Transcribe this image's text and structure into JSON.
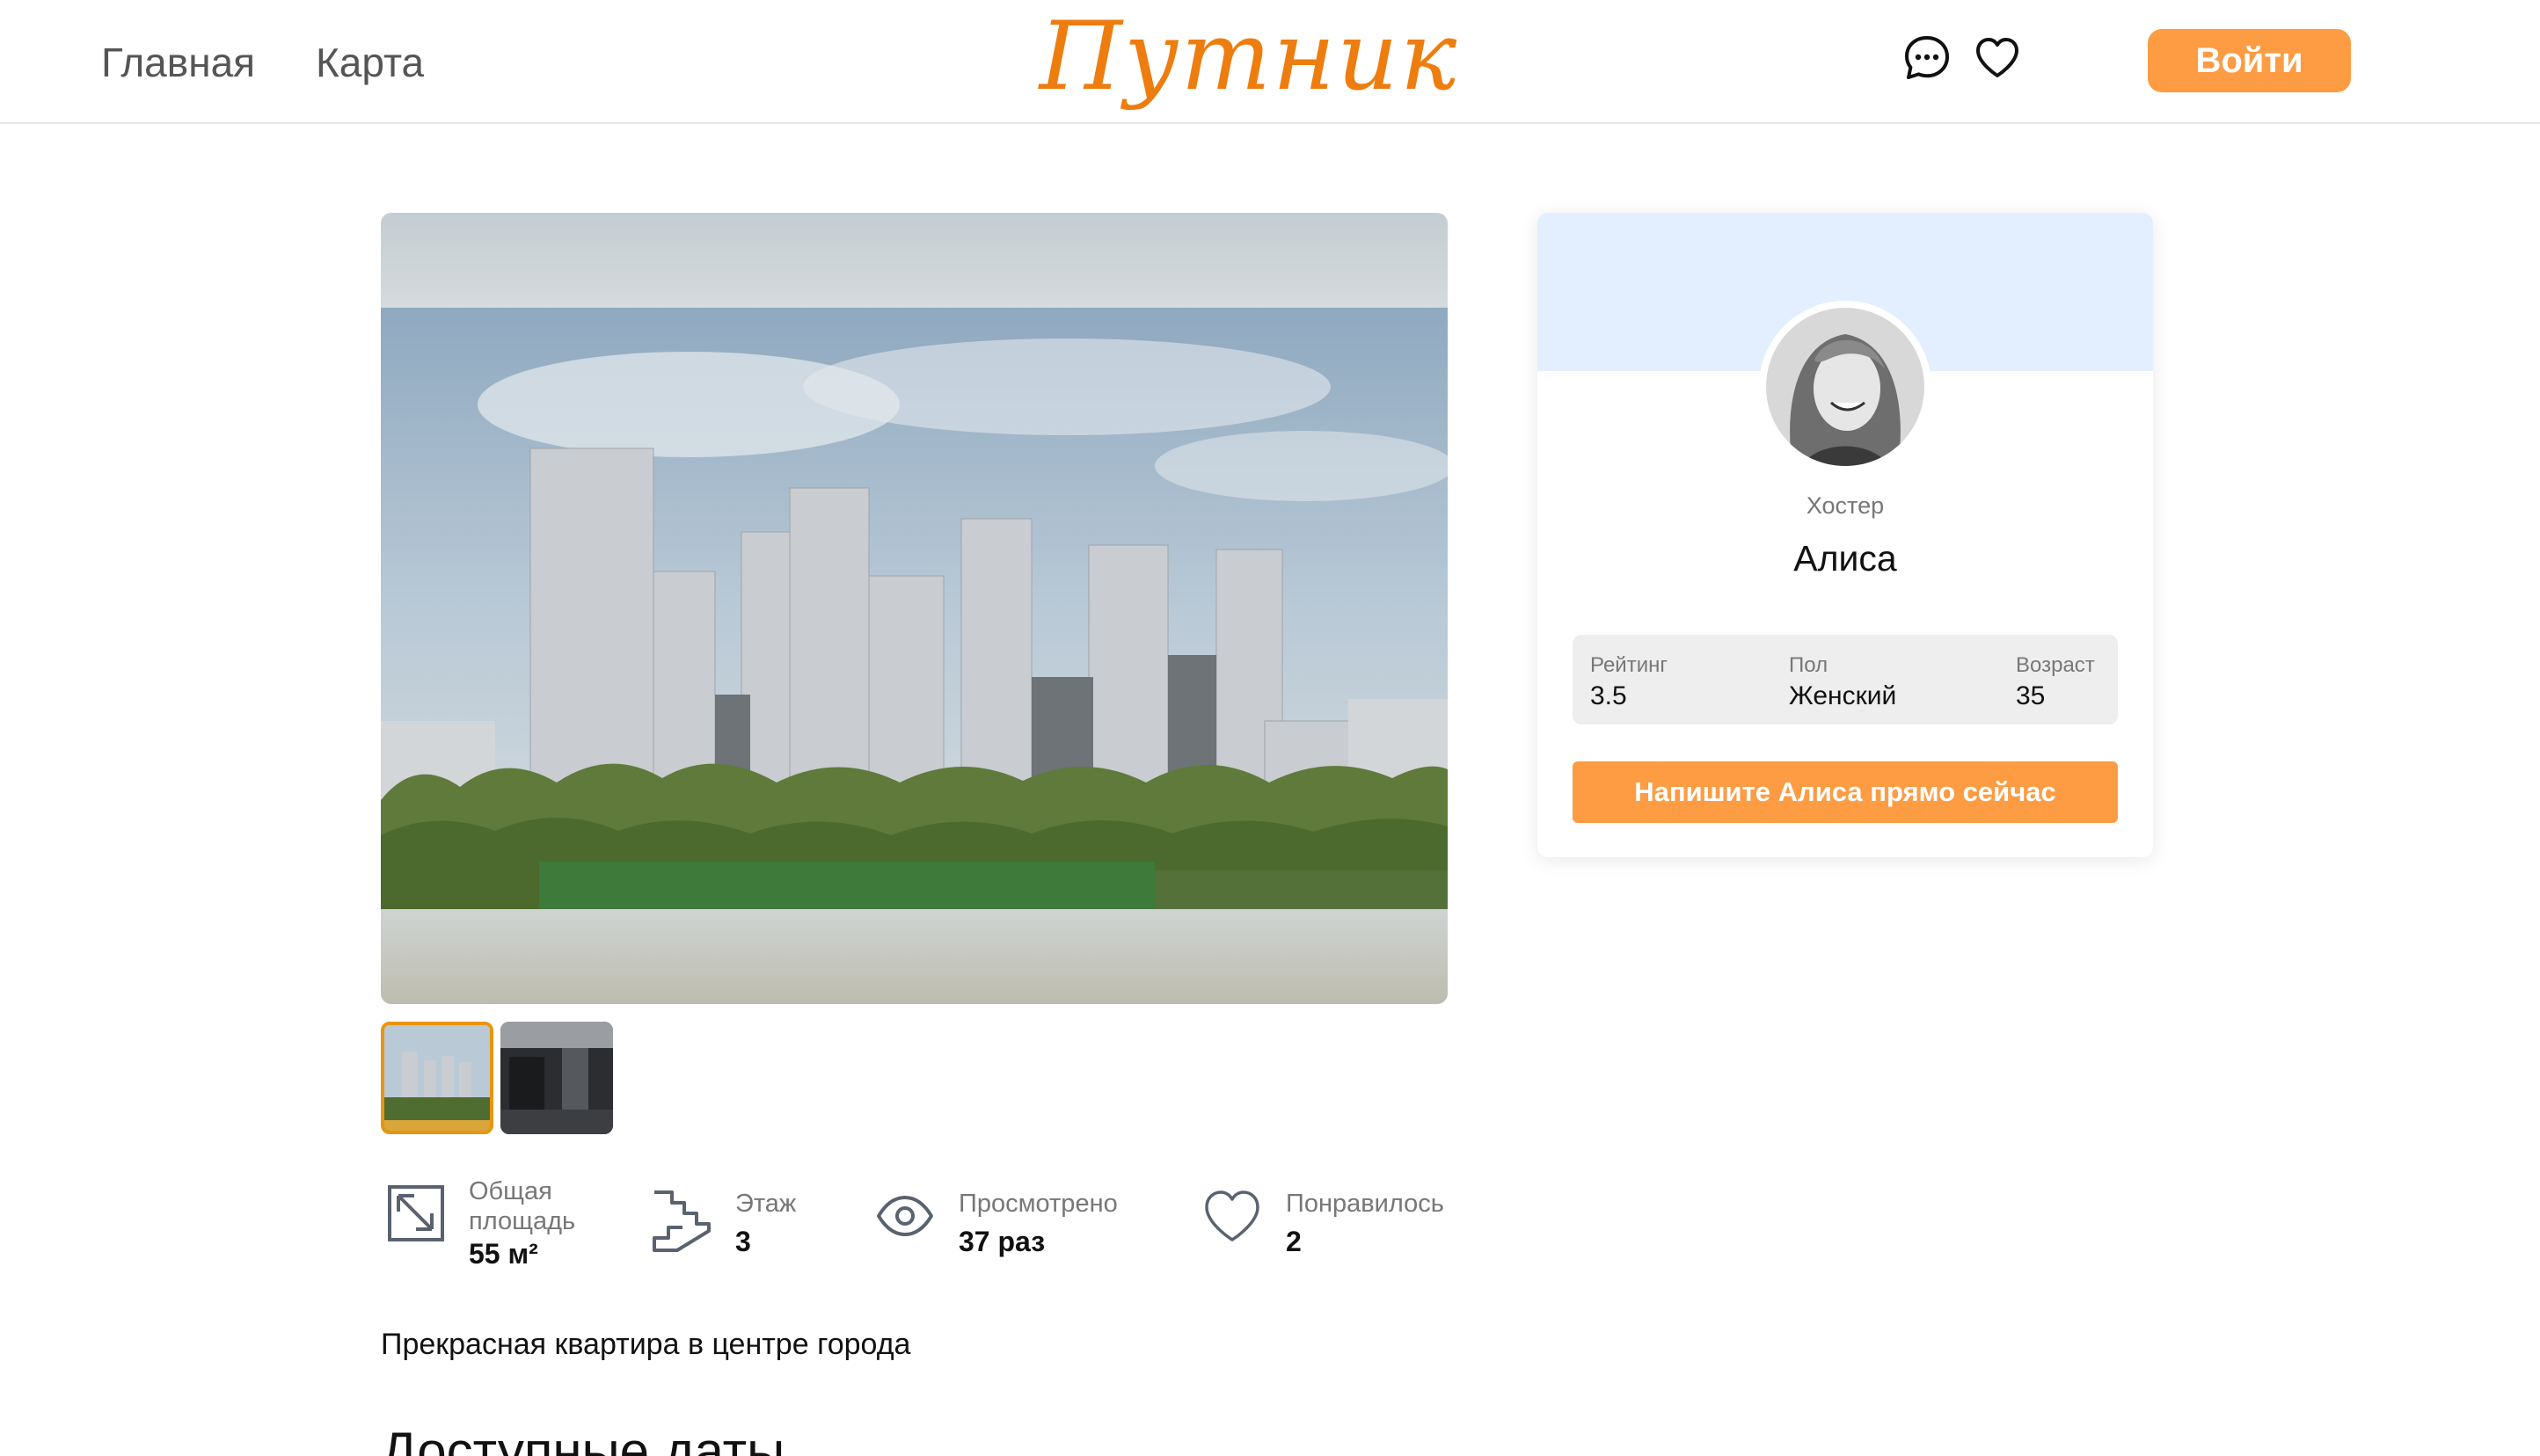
{
  "header": {
    "nav": [
      {
        "label": "Главная"
      },
      {
        "label": "Карта"
      }
    ],
    "logo": "Путник",
    "icons": [
      "chat-icon",
      "heart-icon"
    ],
    "login_label": "Войти"
  },
  "listing": {
    "gallery": {
      "thumbnails": 2,
      "selected_index": 0
    },
    "stats": [
      {
        "icon": "area-icon",
        "label": "Общая площадь",
        "value": "55 м²"
      },
      {
        "icon": "stairs-icon",
        "label": "Этаж",
        "value": "3"
      },
      {
        "icon": "eye-icon",
        "label": "Просмотрено",
        "value": "37 раз"
      },
      {
        "icon": "heart-icon",
        "label": "Понравилось",
        "value": "2"
      }
    ],
    "description": "Прекрасная квартира в центре города",
    "dates_title": "Доступные даты"
  },
  "host": {
    "role": "Хостер",
    "name": "Алиса",
    "info": [
      {
        "label": "Рейтинг",
        "value": "3.5"
      },
      {
        "label": "Пол",
        "value": "Женский"
      },
      {
        "label": "Возраст",
        "value": "35"
      }
    ],
    "message_button": "Напишите Алиса прямо сейчас"
  },
  "colors": {
    "accent": "#fd9c43",
    "logo": "#ee7d0f",
    "host_banner": "#e3efff",
    "thumb_selected_border": "#e8960f"
  }
}
